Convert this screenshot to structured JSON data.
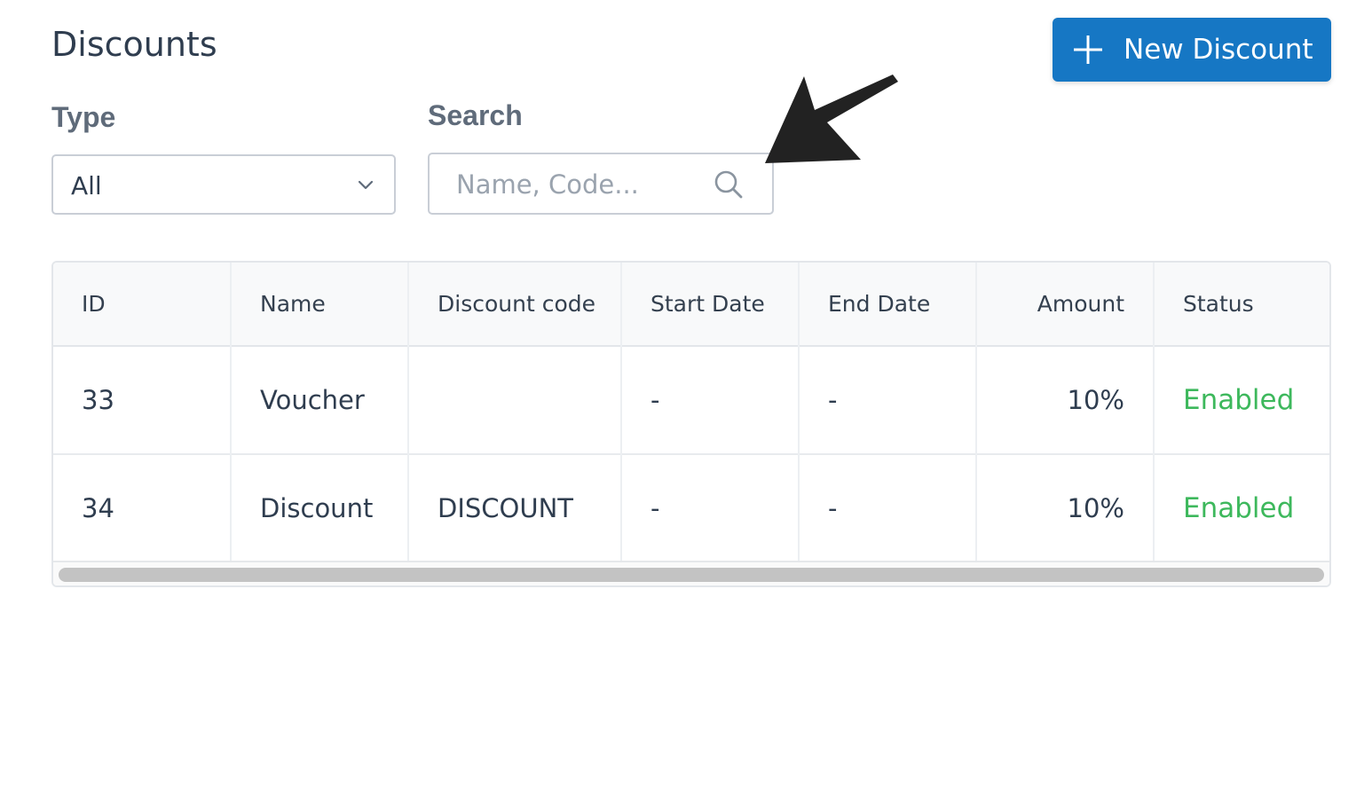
{
  "header": {
    "title": "Discounts",
    "new_button_label": "New Discount",
    "accent_color": "#1677c4"
  },
  "filters": {
    "type_label": "Type",
    "type_value": "All",
    "search_label": "Search",
    "search_placeholder": "Name, Code..."
  },
  "table": {
    "columns": [
      "ID",
      "Name",
      "Discount code",
      "Start Date",
      "End Date",
      "Amount",
      "Status"
    ],
    "rows": [
      {
        "id": "33",
        "name": "Voucher",
        "code": "",
        "start": "-",
        "end": "-",
        "amount": "10%",
        "status": "Enabled"
      },
      {
        "id": "34",
        "name": "Discount",
        "code": "DISCOUNT",
        "start": "-",
        "end": "-",
        "amount": "10%",
        "status": "Enabled"
      }
    ],
    "status_color": "#3db85c"
  },
  "annotation": {
    "icon": "arrow-pointer-icon",
    "color": "#222222"
  }
}
